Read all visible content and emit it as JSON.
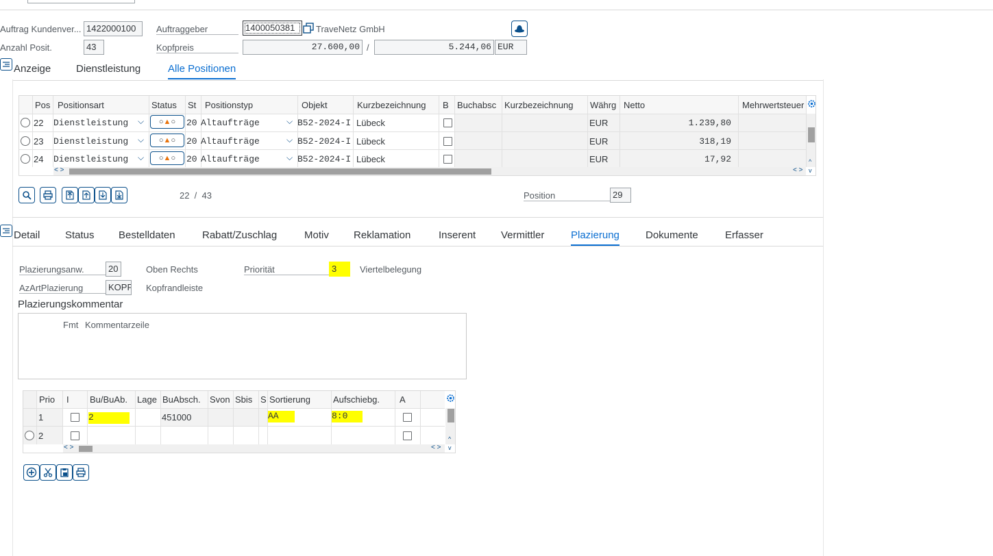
{
  "header": {
    "auftrag_label": "Auftrag Kundenver...",
    "auftrag_value": "1422000100",
    "auftraggeber_label": "Auftraggeber",
    "auftraggeber_value": "1400050381",
    "auftraggeber_name": "TraveNetz GmbH",
    "anzahl_label": "Anzahl Posit.",
    "anzahl_value": "43",
    "kopfpreis_label": "Kopfpreis",
    "kopfpreis_value": "27.600,00",
    "kopfpreis_sep": "/",
    "kopfpreis_value2": "5.244,06",
    "currency": "EUR"
  },
  "top_tabs": [
    {
      "label": "Anzeige"
    },
    {
      "label": "Dienstleistung"
    },
    {
      "label": "Alle Positionen",
      "active": true
    }
  ],
  "positions_table": {
    "columns": [
      "Pos",
      "Positionsart",
      "Status",
      "St",
      "Positionstyp",
      "Objekt",
      "Kurzbezeichnung",
      "B",
      "Buchabsc",
      "Kurzbezeichnung",
      "Währg",
      "Netto",
      "Mehrwertsteuer"
    ],
    "rows": [
      {
        "pos": "22",
        "art": "Dienstleistung",
        "st": "20",
        "typ": "Altaufträge",
        "objekt": "B52-2024-I",
        "kurz": "Lübeck",
        "waehrg": "EUR",
        "netto": "1.239,80"
      },
      {
        "pos": "23",
        "art": "Dienstleistung",
        "st": "20",
        "typ": "Altaufträge",
        "objekt": "B52-2024-I",
        "kurz": "Lübeck",
        "waehrg": "EUR",
        "netto": "318,19"
      },
      {
        "pos": "24",
        "art": "Dienstleistung",
        "st": "20",
        "typ": "Altaufträge",
        "objekt": "B52-2024-I",
        "kurz": "Lübeck",
        "waehrg": "EUR",
        "netto": "17,92"
      }
    ],
    "status_glyphs": "○▲○",
    "pager": "22  /  43",
    "position_label": "Position",
    "position_value": "29"
  },
  "detail_tabs": [
    {
      "label": "Detail"
    },
    {
      "label": "Status"
    },
    {
      "label": "Bestelldaten"
    },
    {
      "label": "Rabatt/Zuschlag"
    },
    {
      "label": "Motiv"
    },
    {
      "label": "Reklamation"
    },
    {
      "label": "Inserent"
    },
    {
      "label": "Vermittler"
    },
    {
      "label": "Plazierung",
      "active": true
    },
    {
      "label": "Dokumente"
    },
    {
      "label": "Erfasser"
    }
  ],
  "plazierung": {
    "anw_label": "Plazierungsanw.",
    "anw_value": "20",
    "anw_text": "Oben Rechts",
    "prio_label": "Priorität",
    "prio_value": "3",
    "prio_text": "Viertelbelegung",
    "azart_label": "AzArtPlazierung",
    "azart_value": "KOPF",
    "azart_text": "Kopfrandleiste",
    "kommentar_label": "Plazierungskommentar",
    "fmt_label": "Fmt",
    "kommentar_col": "Kommentarzeile"
  },
  "prio_table": {
    "columns": [
      "Prio",
      "I",
      "Bu/BuAb.",
      "Lage",
      "BuAbsch.",
      "Svon",
      "Sbis",
      "S",
      "Sortierung",
      "Aufschiebg.",
      "A"
    ],
    "rows": [
      {
        "prio": "1",
        "bu": "2",
        "buabsch": "451000",
        "sortierung": "AA",
        "aufschiebg": "8:0"
      },
      {
        "prio": "2",
        "bu": "",
        "buabsch": "",
        "sortierung": "",
        "aufschiebg": ""
      }
    ]
  },
  "colors": {
    "accent": "#0a6ed1",
    "icon": "#0a4f8a",
    "highlight": "#ffff00"
  }
}
